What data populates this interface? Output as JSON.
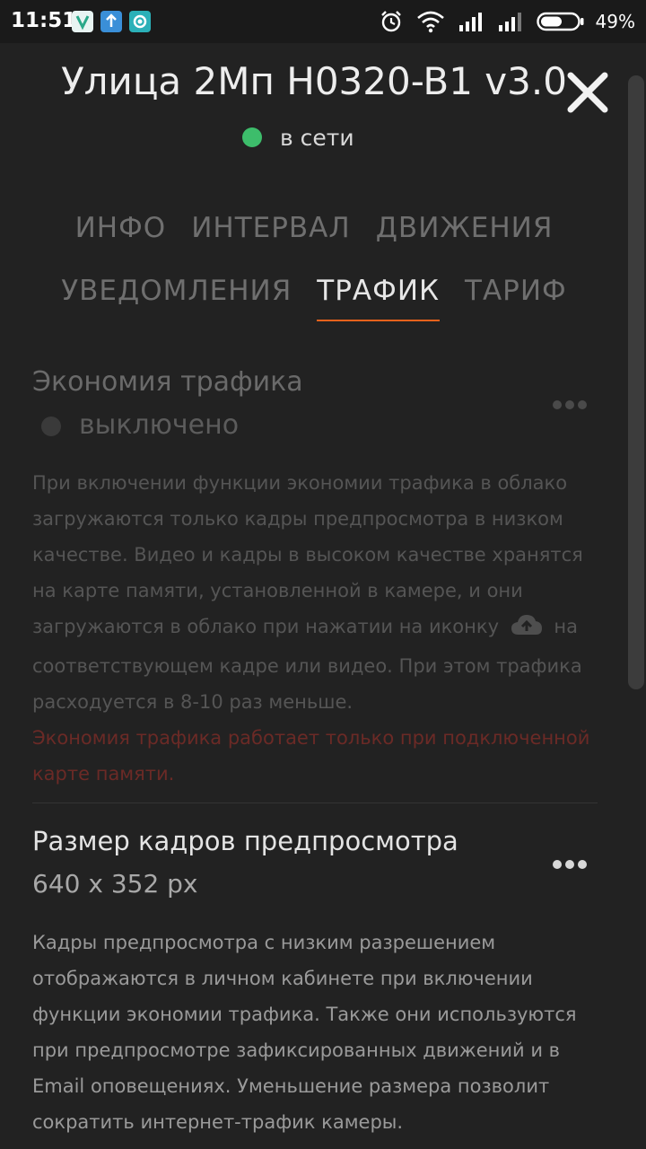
{
  "status_bar": {
    "time": "11:51",
    "battery_percent": "49%",
    "app_icons": [
      "vivaldi-app-icon",
      "upload-app-icon",
      "camera-app-icon"
    ],
    "icons": [
      "alarm-icon",
      "wifi-icon",
      "signal-icon",
      "signal-icon-2",
      "battery-icon"
    ]
  },
  "dialog": {
    "title": "Улица 2Мп H0320-B1 v3.0",
    "status_text": "в сети",
    "status_color": "#3dbd6b"
  },
  "tabs": [
    {
      "label": "ИНФО",
      "active": false
    },
    {
      "label": "ИНТЕРВАЛ",
      "active": false
    },
    {
      "label": "ДВИЖЕНИЯ",
      "active": false
    },
    {
      "label": "УВЕДОМЛЕНИЯ",
      "active": false
    },
    {
      "label": "ТРАФИК",
      "active": true
    },
    {
      "label": "ТАРИФ",
      "active": false
    }
  ],
  "accent_color": "#e8621c",
  "traffic_saving": {
    "title": "Экономия трафика",
    "status": "выключено",
    "description_part1": "При включении функции экономии трафика в облако загружаются только кадры предпросмотра в низком качестве. Видео и кадры в высоком качестве хранятся на карте памяти, установленной в камере, и они загружаются в облако при нажатии на иконку",
    "description_part2": "на соответствующем кадре или видео. При этом трафика расходуется в 8-10 раз меньше.",
    "warning": "Экономия трафика работает только при подключенной карте памяти."
  },
  "preview_size": {
    "title": "Размер кадров предпросмотра",
    "value": "640 x 352 px",
    "description": "Кадры предпросмотра с низким разрешением отображаются в личном кабинете при включении функции экономии трафика. Также они используются при предпросмотре зафиксированных движений и в Email оповещениях. Уменьшение размера позволит сократить интернет-трафик камеры."
  }
}
